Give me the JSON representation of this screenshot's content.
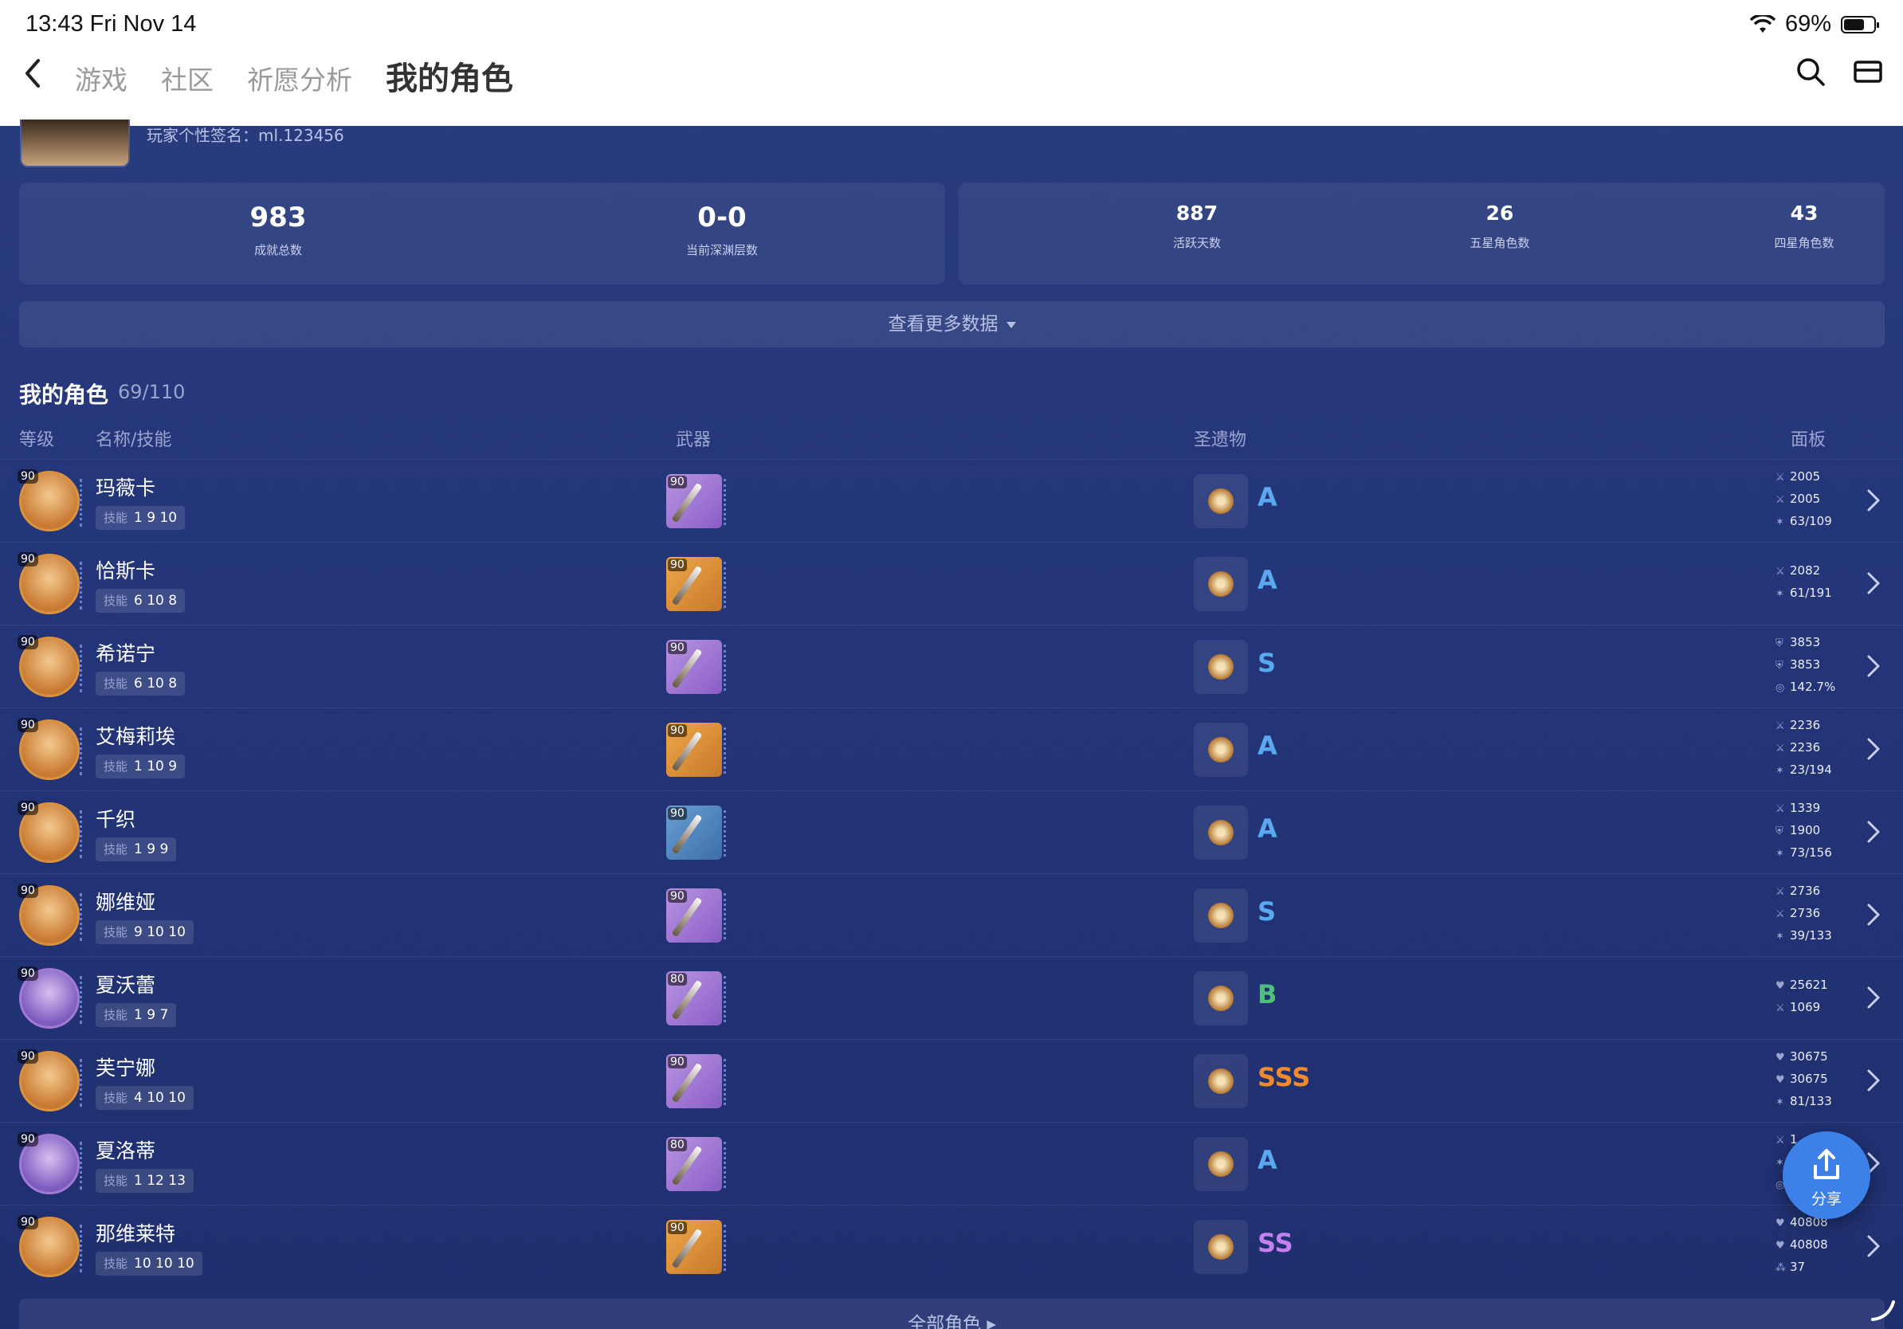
{
  "status": {
    "time": "13:43  Fri Nov 14",
    "battery": "69%"
  },
  "nav": {
    "tabs": [
      "游戏",
      "社区",
      "祈愿分析",
      "我的角色"
    ],
    "active": 3
  },
  "profile": {
    "signature": "玩家个性签名：ml.123456"
  },
  "stats_left": [
    {
      "value": "983",
      "label": "成就总数"
    },
    {
      "value": "0-0",
      "label": "当前深渊层数"
    }
  ],
  "stats_right": [
    {
      "value": "887",
      "label": "活跃天数"
    },
    {
      "value": "26",
      "label": "五星角色数"
    },
    {
      "value": "43",
      "label": "四星角色数"
    }
  ],
  "more_data": "查看更多数据",
  "section": {
    "title": "我的角色",
    "count": "69/110"
  },
  "columns": {
    "level": "等级",
    "name": "名称/技能",
    "weapon": "武器",
    "artifact": "圣遗物",
    "panel": "面板"
  },
  "skill_label": "技能",
  "characters": [
    {
      "lvl": "90",
      "name": "玛薇卡",
      "skills": "1  9  10",
      "weapon_lvl": "90",
      "weapon_rarity": "4",
      "grade": "A",
      "grade_color": "#5aa8f0",
      "avatar": "orange",
      "stats": [
        [
          "atk",
          "2005"
        ],
        [
          "atk",
          "2005"
        ],
        [
          "crit",
          "63/109"
        ]
      ]
    },
    {
      "lvl": "90",
      "name": "恰斯卡",
      "skills": "6  10  8",
      "weapon_lvl": "90",
      "weapon_rarity": "5",
      "grade": "A",
      "grade_color": "#5aa8f0",
      "avatar": "orange",
      "stats": [
        [
          "atk",
          "2082"
        ],
        [
          "crit",
          "61/191"
        ]
      ]
    },
    {
      "lvl": "90",
      "name": "希诺宁",
      "skills": "6  10  8",
      "weapon_lvl": "90",
      "weapon_rarity": "4",
      "grade": "S",
      "grade_color": "#5aa8f0",
      "avatar": "orange",
      "stats": [
        [
          "def",
          "3853"
        ],
        [
          "def",
          "3853"
        ],
        [
          "er",
          "142.7%"
        ]
      ]
    },
    {
      "lvl": "90",
      "name": "艾梅莉埃",
      "skills": "1  10  9",
      "weapon_lvl": "90",
      "weapon_rarity": "5",
      "grade": "A",
      "grade_color": "#5aa8f0",
      "avatar": "orange",
      "stats": [
        [
          "atk",
          "2236"
        ],
        [
          "atk",
          "2236"
        ],
        [
          "crit",
          "23/194"
        ]
      ]
    },
    {
      "lvl": "90",
      "name": "千织",
      "skills": "1  9  9",
      "weapon_lvl": "90",
      "weapon_rarity": "3",
      "grade": "A",
      "grade_color": "#5aa8f0",
      "avatar": "orange",
      "stats": [
        [
          "atk",
          "1339"
        ],
        [
          "def",
          "1900"
        ],
        [
          "crit",
          "73/156"
        ]
      ]
    },
    {
      "lvl": "90",
      "name": "娜维娅",
      "skills": "9  10  10",
      "weapon_lvl": "90",
      "weapon_rarity": "4",
      "grade": "S",
      "grade_color": "#5aa8f0",
      "avatar": "orange",
      "stats": [
        [
          "atk",
          "2736"
        ],
        [
          "atk",
          "2736"
        ],
        [
          "crit",
          "39/133"
        ]
      ]
    },
    {
      "lvl": "90",
      "name": "夏沃蕾",
      "skills": "1  9  7",
      "weapon_lvl": "80",
      "weapon_rarity": "4",
      "grade": "B",
      "grade_color": "#4fc07a",
      "avatar": "purple",
      "stats": [
        [
          "hp",
          "25621"
        ],
        [
          "atk",
          "1069"
        ]
      ]
    },
    {
      "lvl": "90",
      "name": "芙宁娜",
      "skills": "4  10  10",
      "weapon_lvl": "90",
      "weapon_rarity": "4",
      "grade": "SSS",
      "grade_color": "#f08a2e",
      "avatar": "orange",
      "stats": [
        [
          "hp",
          "30675"
        ],
        [
          "hp",
          "30675"
        ],
        [
          "crit",
          "81/133"
        ]
      ]
    },
    {
      "lvl": "90",
      "name": "夏洛蒂",
      "skills": "1  12  13",
      "weapon_lvl": "80",
      "weapon_rarity": "4",
      "grade": "A",
      "grade_color": "#5aa8f0",
      "avatar": "purple",
      "stats": [
        [
          "atk",
          "1"
        ],
        [
          "crit",
          ""
        ],
        [
          "er",
          ""
        ]
      ]
    },
    {
      "lvl": "90",
      "name": "那维莱特",
      "skills": "10  10  10",
      "weapon_lvl": "90",
      "weapon_rarity": "5",
      "grade": "SS",
      "grade_color": "#c480f0",
      "avatar": "orange",
      "stats": [
        [
          "hp",
          "40808"
        ],
        [
          "hp",
          "40808"
        ],
        [
          "em",
          "37"
        ]
      ]
    }
  ],
  "share_label": "分享",
  "all_chars": "全部角色",
  "icons": {
    "back": "chevron-left-icon",
    "search": "search-icon",
    "mail": "mail-icon",
    "share": "share-icon"
  }
}
